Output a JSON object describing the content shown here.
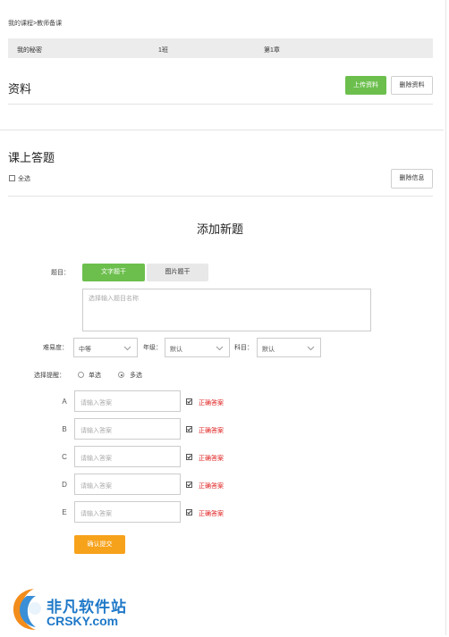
{
  "breadcrumb": "我的课程>教师备课",
  "info_bar": {
    "col1": "我的秘密",
    "col2": "1班",
    "col3": "第1章"
  },
  "materials": {
    "title": "资料",
    "upload_button": "上传资料",
    "delete_button": "删除资料"
  },
  "quiz": {
    "title": "课上答题",
    "select_all": "全选",
    "delete_button": "删除信息"
  },
  "form": {
    "title": "添加新题",
    "question_label": "题目：",
    "tab_text": "文字题干",
    "tab_image": "图片题干",
    "question_placeholder": "选择输入题目名称",
    "difficulty_label": "难易度：",
    "difficulty_value": "中等",
    "grade_label": "年级：",
    "grade_value": "默认",
    "subject_label": "科目：",
    "subject_value": "默认",
    "selection_label": "选择提醒：",
    "single_label": "单选",
    "multi_label": "多选",
    "selection_selected": "多选",
    "answer_placeholder": "请输入答案",
    "correct_label": "正确答案",
    "options": [
      {
        "letter": "A",
        "checked": true
      },
      {
        "letter": "B",
        "checked": true
      },
      {
        "letter": "C",
        "checked": true
      },
      {
        "letter": "D",
        "checked": true
      },
      {
        "letter": "E",
        "checked": true
      }
    ],
    "submit_button": "确认提交"
  },
  "watermark": {
    "line1": "非凡软件站",
    "line2": "CRSKY.com"
  },
  "colors": {
    "green": "#6cbf4d",
    "orange": "#f7a21b",
    "red": "#e02020",
    "info_bar": "#ececec"
  }
}
